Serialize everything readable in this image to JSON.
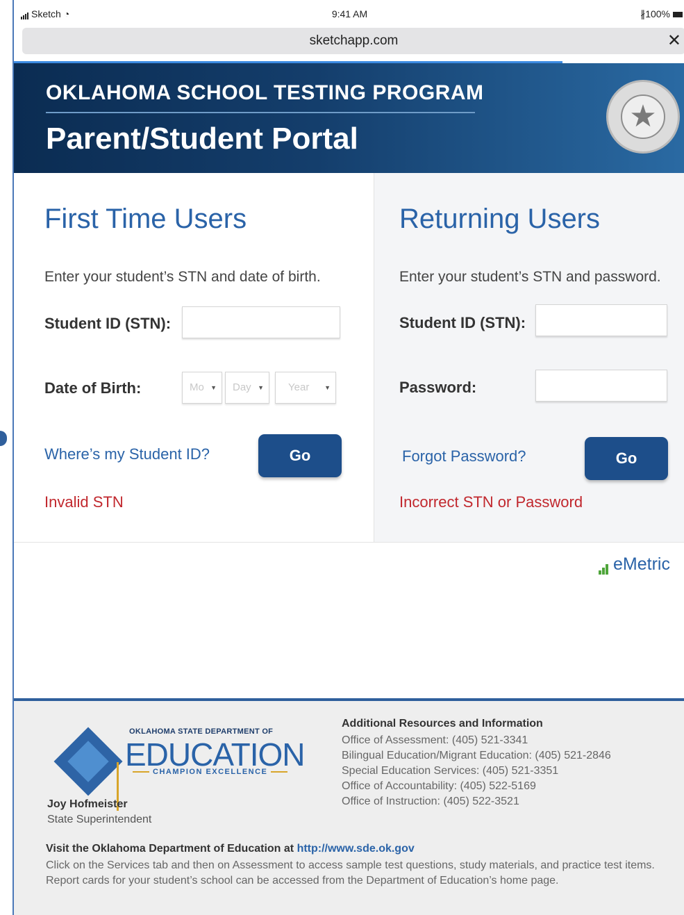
{
  "status_bar": {
    "carrier": "Sketch",
    "time": "9:41 AM",
    "battery": "100%"
  },
  "browser": {
    "url": "sketchapp.com",
    "close_label": "✕"
  },
  "header": {
    "program": "OKLAHOMA SCHOOL TESTING PROGRAM",
    "portal": "Parent/Student Portal",
    "seal_icon": "star-seal-icon"
  },
  "first_time": {
    "title": "First Time Users",
    "description": "Enter your student’s STN and date of birth.",
    "stn_label": "Student ID (STN):",
    "stn_value": "",
    "dob_label": "Date of Birth:",
    "dob_month": "Mo",
    "dob_day": "Day",
    "dob_year": "Year",
    "help_link": "Where’s my Student ID?",
    "go_label": "Go",
    "error": "Invalid STN"
  },
  "returning": {
    "title": "Returning Users",
    "description": "Enter your student’s STN and password.",
    "stn_label": "Student ID (STN):",
    "stn_value": "",
    "password_label": "Password:",
    "password_value": "",
    "forgot_link": "Forgot Password?",
    "go_label": "Go",
    "error": "Incorrect STN or Password"
  },
  "vendor": {
    "name": "eMetric"
  },
  "footer": {
    "dept_small": "OKLAHOMA STATE DEPARTMENT OF",
    "dept_big": "EDUCATION",
    "dept_tagline": "CHAMPION EXCELLENCE",
    "superintendent_name": "Joy Hofmeister",
    "superintendent_title": "State Superintendent",
    "resources_title": "Additional Resources and Information",
    "resources": [
      "Office of Assessment: (405) 521-3341",
      "Bilingual Education/Migrant Education: (405) 521-2846",
      "Special Education Services: (405) 521-3351",
      "Office of Accountability: (405) 522-5169",
      "Office of Instruction: (405) 522-3521"
    ],
    "visit_text": "Visit the Oklahoma Department of Education at",
    "visit_link": "http://www.sde.ok.gov",
    "info_text": "Click on the Services tab and then on Assessment to access sample test questions, study materials, and practice test items.  Report cards for your student’s school can be accessed from the Department of Education’s home page."
  },
  "colors": {
    "brand_blue": "#2a63a8",
    "button_blue": "#1d4e8a",
    "error_red": "#c1272d",
    "header_dark": "#0b2c52"
  }
}
